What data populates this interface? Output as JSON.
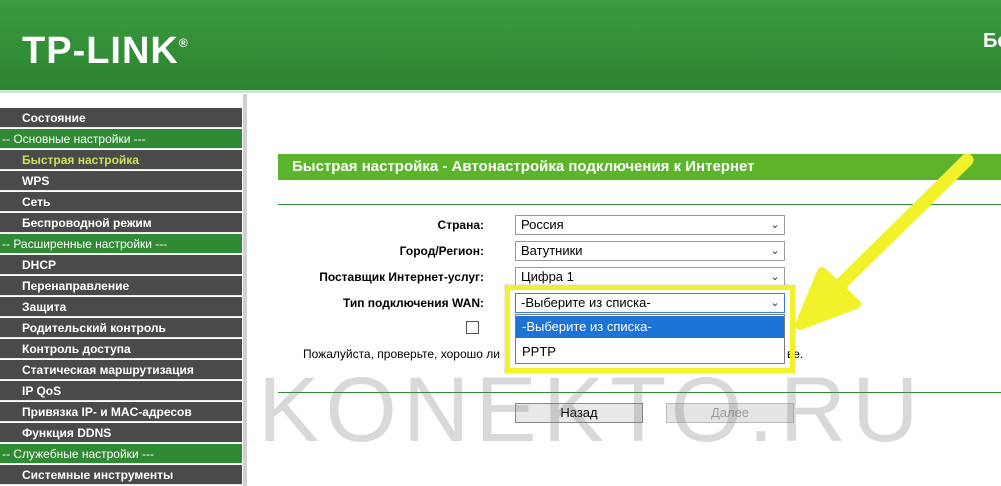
{
  "header": {
    "brand": "TP-LINK",
    "brand_mark": "®",
    "right_text": "Бе"
  },
  "sidebar": {
    "items": [
      {
        "label": "Состояние",
        "type": "sub"
      },
      {
        "label": "-- Основные настройки ---",
        "type": "section"
      },
      {
        "label": "Быстрая настройка",
        "type": "sub",
        "active": true
      },
      {
        "label": "WPS",
        "type": "sub"
      },
      {
        "label": "Сеть",
        "type": "sub"
      },
      {
        "label": "Беспроводной режим",
        "type": "sub"
      },
      {
        "label": "-- Расширенные настройки ---",
        "type": "section"
      },
      {
        "label": "DHCP",
        "type": "sub"
      },
      {
        "label": "Перенаправление",
        "type": "sub"
      },
      {
        "label": "Защита",
        "type": "sub"
      },
      {
        "label": "Родительский контроль",
        "type": "sub"
      },
      {
        "label": "Контроль доступа",
        "type": "sub"
      },
      {
        "label": "Статическая маршрутизация",
        "type": "sub"
      },
      {
        "label": "IP QoS",
        "type": "sub"
      },
      {
        "label": "Привязка IP- и MAC-адресов",
        "type": "sub"
      },
      {
        "label": "Функция DDNS",
        "type": "sub"
      },
      {
        "label": "-- Служебные настройки ---",
        "type": "section"
      },
      {
        "label": "Системные инструменты",
        "type": "sub"
      }
    ]
  },
  "main": {
    "title": "Быстрая настройка - Автонастройка подключения к Интернет",
    "fields": {
      "country": {
        "label": "Страна:",
        "value": "Россия"
      },
      "city": {
        "label": "Город/Регион:",
        "value": "Ватутники"
      },
      "isp": {
        "label": "Поставщик Интернет-услуг:",
        "value": "Цифра 1"
      },
      "wan": {
        "label": "Тип подключения WAN:",
        "value": "-Выберите из списка-"
      }
    },
    "wan_options": [
      "-Выберите из списка-",
      "PPTP"
    ],
    "notice_start": "Пожалуйста, проверьте, хорошо ли",
    "notice_end": "ве.",
    "buttons": {
      "back": "Назад",
      "next": "Далее"
    }
  },
  "overlay": {
    "watermark": "KONEKTO.RU",
    "highlight_color": "#f2f22a"
  },
  "colors": {
    "header_green": "#2f8a33",
    "title_green": "#5cb42a",
    "sidebar_dark": "#4a4a4a",
    "active_item": "#c8e25a",
    "selection_blue": "#1e73d6"
  }
}
